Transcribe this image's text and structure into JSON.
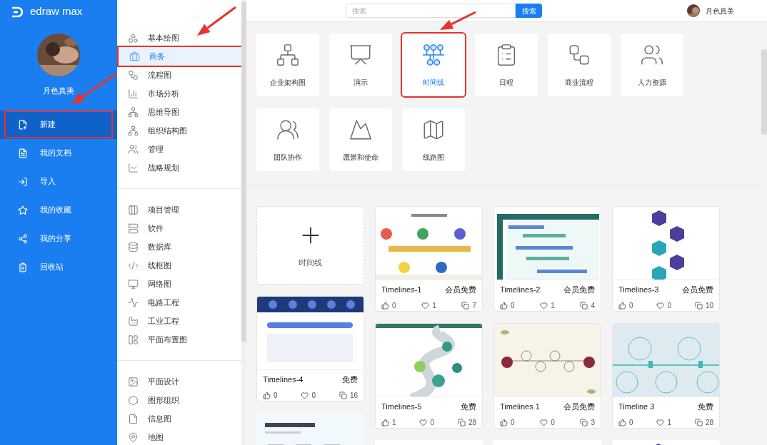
{
  "sidebar": {
    "logo": "edraw max",
    "user_name": "月色真美",
    "items": [
      {
        "label": "新建",
        "selected": true,
        "annotated": true
      },
      {
        "label": "我的文档",
        "selected": false,
        "annotated": false
      },
      {
        "label": "导入",
        "selected": false,
        "annotated": false
      },
      {
        "label": "我的收藏",
        "selected": false,
        "annotated": false
      },
      {
        "label": "我的分享",
        "selected": false,
        "annotated": false
      },
      {
        "label": "回收站",
        "selected": false,
        "annotated": false
      }
    ]
  },
  "categories": {
    "groups": [
      {
        "items": [
          {
            "label": "基本绘图",
            "selected": false,
            "annotated": false
          },
          {
            "label": "商务",
            "selected": true,
            "annotated": true
          },
          {
            "label": "流程图",
            "selected": false,
            "annotated": false
          },
          {
            "label": "市场分析",
            "selected": false,
            "annotated": false
          },
          {
            "label": "思维导图",
            "selected": false,
            "annotated": false
          },
          {
            "label": "组织结构图",
            "selected": false,
            "annotated": false
          },
          {
            "label": "管理",
            "selected": false,
            "annotated": false
          },
          {
            "label": "战略规划",
            "selected": false,
            "annotated": false
          }
        ]
      },
      {
        "items": [
          {
            "label": "项目管理",
            "selected": false,
            "annotated": false
          },
          {
            "label": "软件",
            "selected": false,
            "annotated": false
          },
          {
            "label": "数据库",
            "selected": false,
            "annotated": false
          },
          {
            "label": "线框图",
            "selected": false,
            "annotated": false
          },
          {
            "label": "网络图",
            "selected": false,
            "annotated": false
          },
          {
            "label": "电路工程",
            "selected": false,
            "annotated": false
          },
          {
            "label": "工业工程",
            "selected": false,
            "annotated": false
          },
          {
            "label": "平面布置图",
            "selected": false,
            "annotated": false
          }
        ]
      },
      {
        "items": [
          {
            "label": "平面设计",
            "selected": false,
            "annotated": false
          },
          {
            "label": "图形组织",
            "selected": false,
            "annotated": false
          },
          {
            "label": "信息图",
            "selected": false,
            "annotated": false
          },
          {
            "label": "地图",
            "selected": false,
            "annotated": false
          }
        ]
      }
    ]
  },
  "search": {
    "placeholder": "搜索",
    "button": "搜索"
  },
  "user": {
    "name": "月色真美"
  },
  "subcategories": [
    {
      "label": "企业架构图",
      "selected": false,
      "annotated": false
    },
    {
      "label": "演示",
      "selected": false,
      "annotated": false
    },
    {
      "label": "时间线",
      "selected": true,
      "annotated": true
    },
    {
      "label": "日程",
      "selected": false,
      "annotated": false
    },
    {
      "label": "商业流程",
      "selected": false,
      "annotated": false
    },
    {
      "label": "人力资源",
      "selected": false,
      "annotated": false
    },
    {
      "label": "团队协作",
      "selected": false,
      "annotated": false
    },
    {
      "label": "愿景和使命",
      "selected": false,
      "annotated": false
    },
    {
      "label": "线路图",
      "selected": false,
      "annotated": false
    }
  ],
  "template_columns": [
    [
      {
        "kind": "new",
        "label": "时间线"
      },
      {
        "kind": "template",
        "title": "Timelines-4",
        "price": "免费",
        "likes": "0",
        "favorites": "0",
        "copies": "16"
      },
      {
        "kind": "picture"
      }
    ],
    [
      {
        "kind": "template",
        "title": "Timelines-1",
        "price": "会员免费",
        "likes": "0",
        "favorites": "1",
        "copies": "7"
      },
      {
        "kind": "template",
        "title": "Timelines-5",
        "price": "免费",
        "likes": "1",
        "favorites": "0",
        "copies": "28"
      },
      {
        "kind": "picture"
      }
    ],
    [
      {
        "kind": "template",
        "title": "Timelines-2",
        "price": "会员免费",
        "likes": "0",
        "favorites": "1",
        "copies": "4"
      },
      {
        "kind": "template",
        "title": "Timelines 1",
        "price": "会员免费",
        "likes": "0",
        "favorites": "0",
        "copies": "3"
      },
      {
        "kind": "picture"
      }
    ],
    [
      {
        "kind": "template",
        "title": "Timelines-3",
        "price": "会员免费",
        "likes": "0",
        "favorites": "0",
        "copies": "10"
      },
      {
        "kind": "template",
        "title": "Timeline 3",
        "price": "免费",
        "likes": "0",
        "favorites": "1",
        "copies": "28"
      },
      {
        "kind": "picture"
      }
    ]
  ]
}
